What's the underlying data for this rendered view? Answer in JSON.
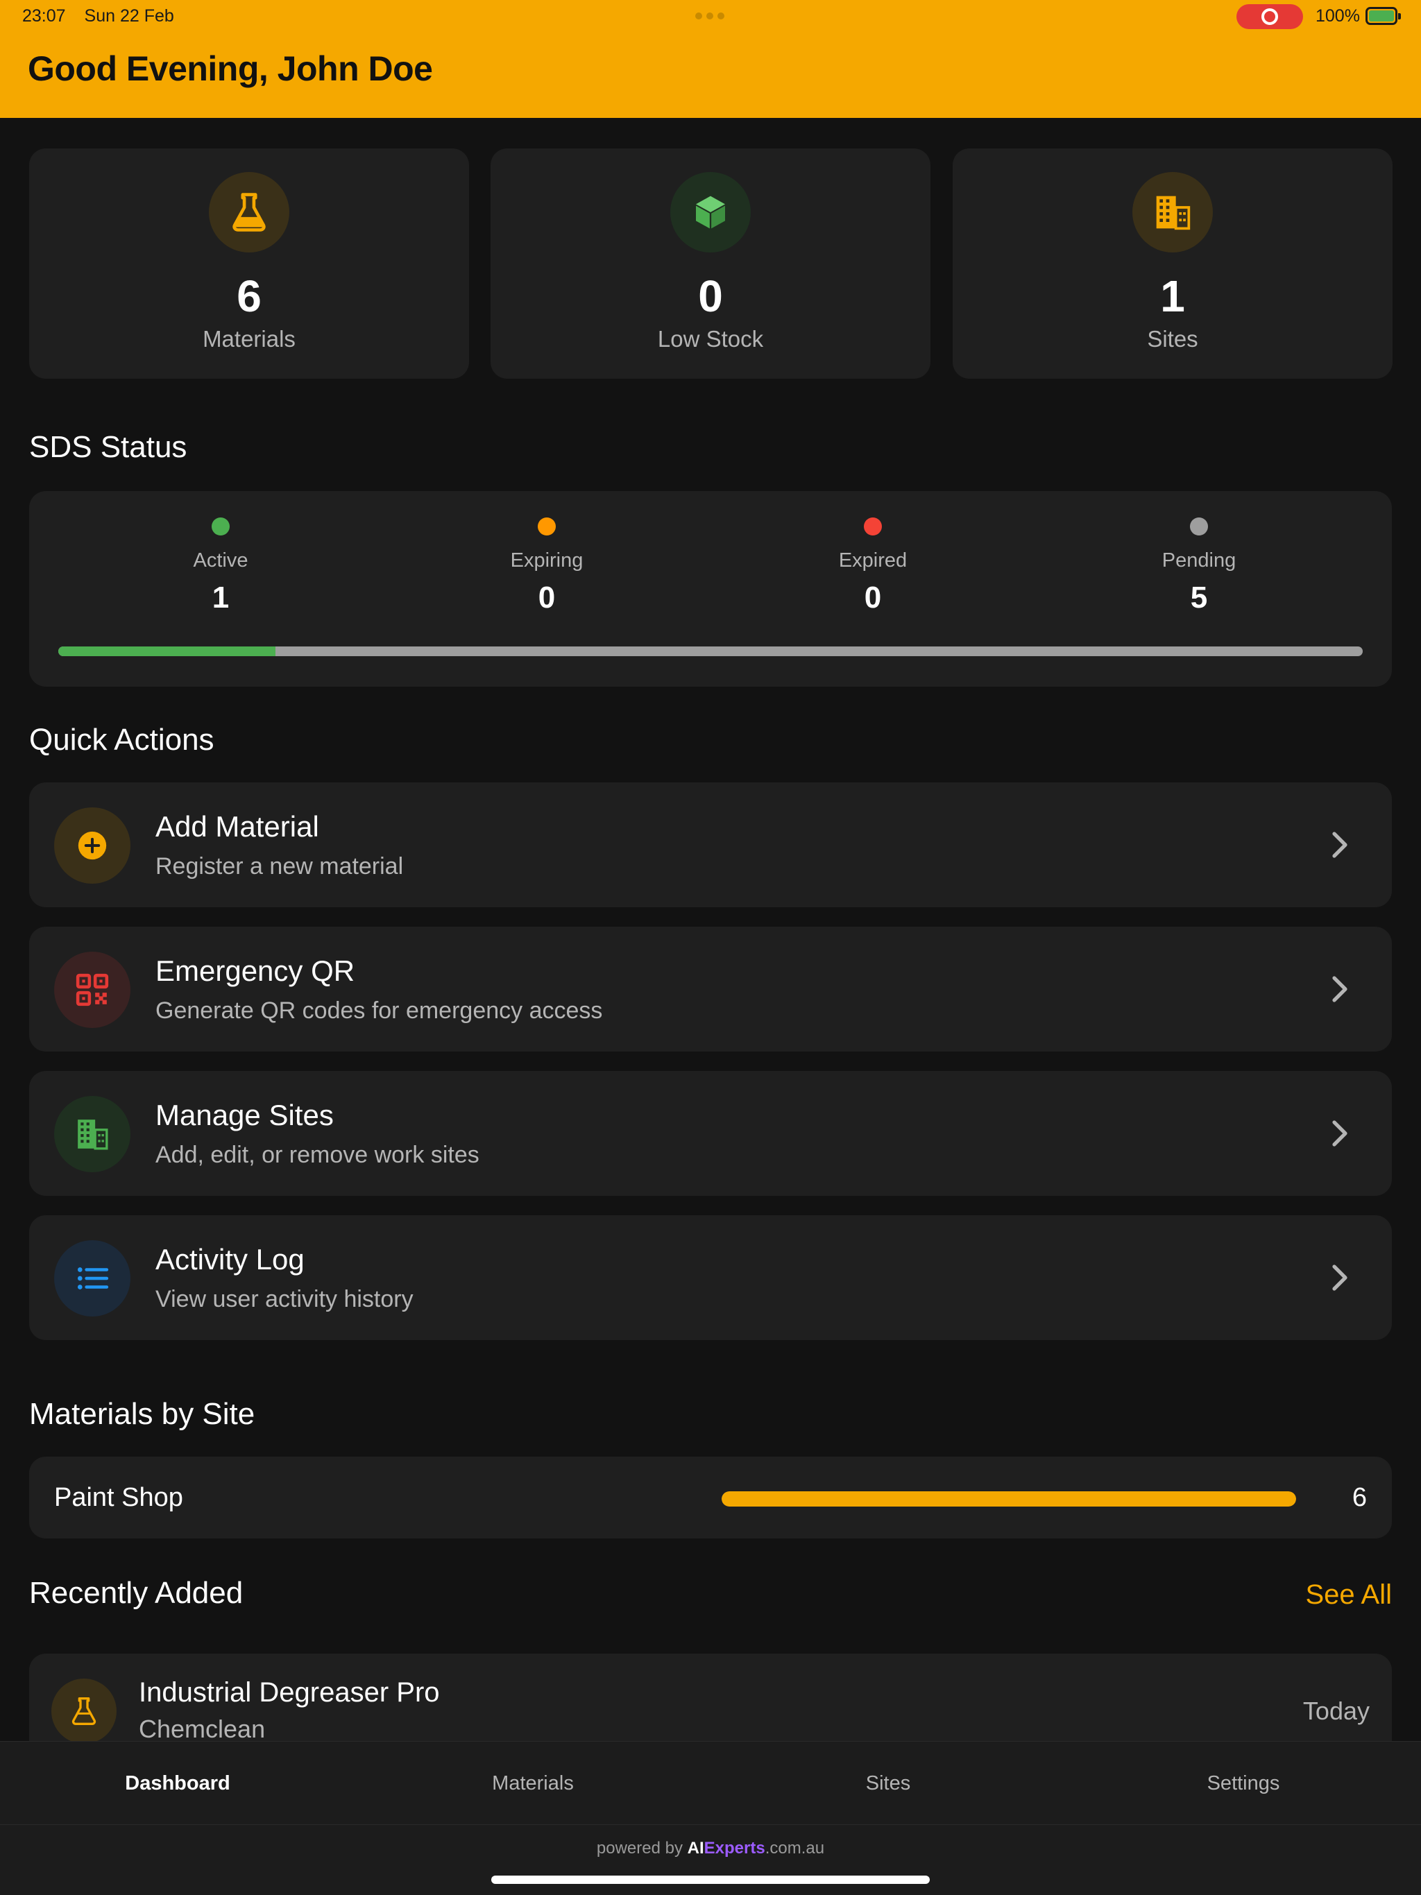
{
  "status_bar": {
    "time": "23:07",
    "date": "Sun 22 Feb",
    "battery": "100%"
  },
  "header": {
    "greeting": "Good Evening, John Doe"
  },
  "stats": [
    {
      "value": "6",
      "label": "Materials",
      "icon": "flask-icon"
    },
    {
      "value": "0",
      "label": "Low Stock",
      "icon": "cube-icon"
    },
    {
      "value": "1",
      "label": "Sites",
      "icon": "building-icon"
    }
  ],
  "sds": {
    "title": "SDS Status",
    "items": [
      {
        "label": "Active",
        "count": "1",
        "color": "#4CAF50"
      },
      {
        "label": "Expiring",
        "count": "0",
        "color": "#FF9800"
      },
      {
        "label": "Expired",
        "count": "0",
        "color": "#F44336"
      },
      {
        "label": "Pending",
        "count": "5",
        "color": "#9E9E9E"
      }
    ],
    "active_fraction": 0.1667
  },
  "quick_actions": {
    "title": "Quick Actions",
    "items": [
      {
        "title": "Add Material",
        "subtitle": "Register a new material",
        "icon": "add-circle-icon"
      },
      {
        "title": "Emergency QR",
        "subtitle": "Generate QR codes for emergency access",
        "icon": "qr-code-icon"
      },
      {
        "title": "Manage Sites",
        "subtitle": "Add, edit, or remove work sites",
        "icon": "building-icon"
      },
      {
        "title": "Activity Log",
        "subtitle": "View user activity history",
        "icon": "list-icon"
      }
    ]
  },
  "materials_by_site": {
    "title": "Materials by Site",
    "sites": [
      {
        "name": "Paint Shop",
        "count": "6",
        "fraction": 1.0
      }
    ]
  },
  "recently_added": {
    "title": "Recently Added",
    "see_all": "See All",
    "items": [
      {
        "name": "Industrial Degreaser Pro",
        "supplier": "Chemclean",
        "date": "Today"
      }
    ]
  },
  "tabs": [
    {
      "label": "Dashboard",
      "active": true
    },
    {
      "label": "Materials",
      "active": false
    },
    {
      "label": "Sites",
      "active": false
    },
    {
      "label": "Settings",
      "active": false
    }
  ],
  "footer": {
    "prefix": "powered by",
    "brand_ai": "AI",
    "brand_experts": "Experts",
    "brand_domain": ".com.au"
  },
  "colors": {
    "accent": "#F5A800",
    "background": "#121212",
    "card": "#1f1f1f"
  }
}
